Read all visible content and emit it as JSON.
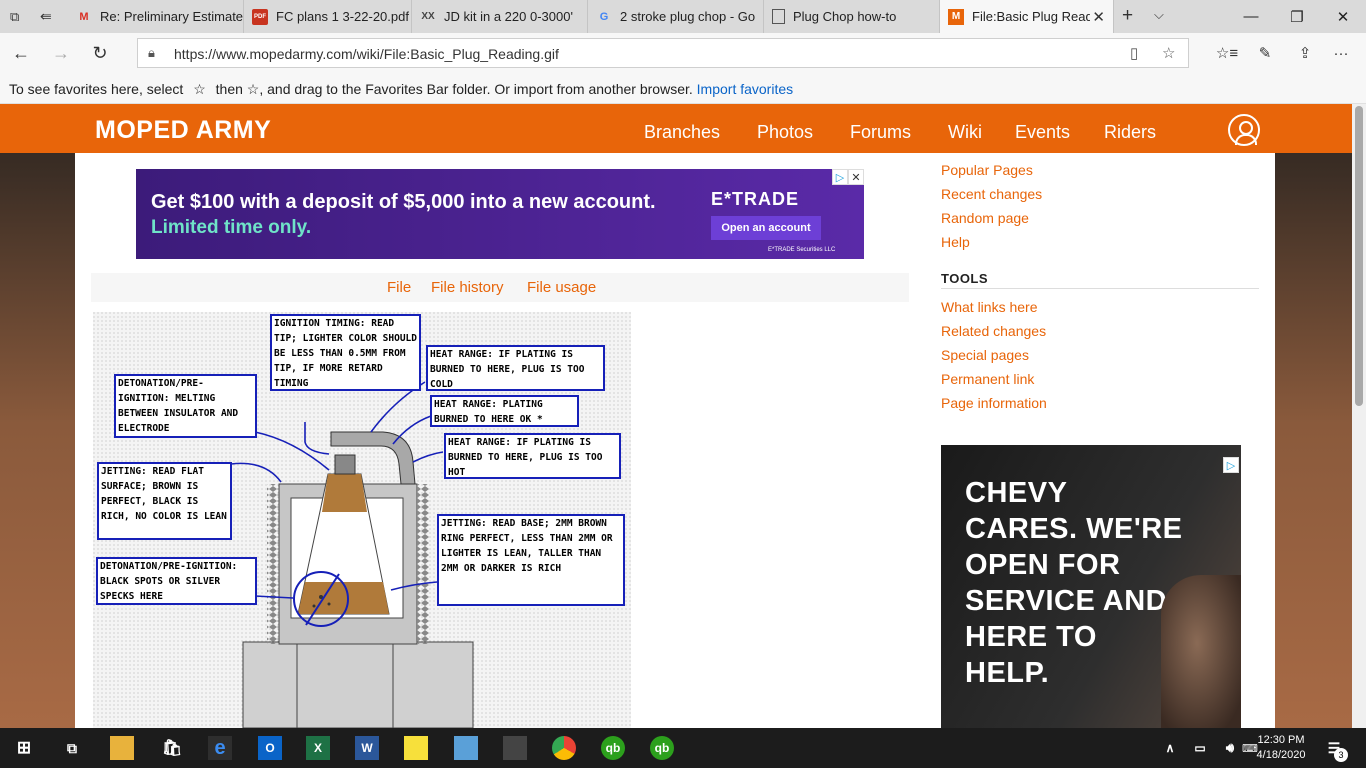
{
  "browser": {
    "tabs": [
      {
        "label": "Re: Preliminary Estimate",
        "icon": "M"
      },
      {
        "label": "FC plans 1 3-22-20.pdf",
        "icon": "PDF"
      },
      {
        "label": "JD kit in a 220 0-3000'",
        "icon": "XX"
      },
      {
        "label": "2 stroke plug chop - Go",
        "icon": "G"
      },
      {
        "label": "Plug Chop how-to",
        "icon": ""
      },
      {
        "label": "File:Basic Plug Reading.gif",
        "icon": "M"
      }
    ],
    "url": "https://www.mopedarmy.com/wiki/File:Basic_Plug_Reading.gif",
    "favorites_message": "To see favorites here, select",
    "favorites_message_2": "then ☆, and drag to the Favorites Bar folder. Or import from another browser.",
    "import_link": "Import favorites"
  },
  "site": {
    "logo": "MOPED ARMY",
    "nav": [
      "Branches",
      "Photos",
      "Forums",
      "Wiki",
      "Events",
      "Riders"
    ]
  },
  "ad_top": {
    "headline": "Get $100 with a deposit of $5,000 into a new account.",
    "subline": "Limited time only.",
    "brand": "E*TRADE",
    "button": "Open an account",
    "fine_print": "E*TRADE Securities LLC"
  },
  "file_tabs": [
    "File",
    "File history",
    "File usage"
  ],
  "diagram": {
    "ignition_timing": "Ignition timing: read tip; lighter color should be less than 0.5mm from tip, if more retard timing",
    "detonation_1": "Detonation/Pre-ignition: melting between insulator and electrode",
    "heat_cold": "Heat range: if plating is burned to here, plug is too cold",
    "heat_ok": "Heat range: plating burned to here ok *",
    "heat_hot": "Heat range: if plating is burned to here, plug is too hot",
    "jetting_flat": "Jetting: read flat surface; brown is perfect, black is rich, no color is lean",
    "jetting_base": "Jetting: read base; 2mm brown ring perfect, less than 2mm or lighter is lean, taller than 2mm or darker is rich",
    "detonation_2": "Detonation/Pre-ignition: black spots or silver specks here"
  },
  "sidebar": {
    "links_top": [
      "Popular Pages",
      "Recent changes",
      "Random page",
      "Help"
    ],
    "tools_heading": "TOOLS",
    "tools": [
      "What links here",
      "Related changes",
      "Special pages",
      "Permanent link",
      "Page information"
    ]
  },
  "ad_side": {
    "text": "CHEVY CARES. WE'RE OPEN FOR SERVICE AND HERE TO HELP."
  },
  "taskbar": {
    "time": "12:30 PM",
    "date": "4/18/2020",
    "notifications": "3"
  }
}
